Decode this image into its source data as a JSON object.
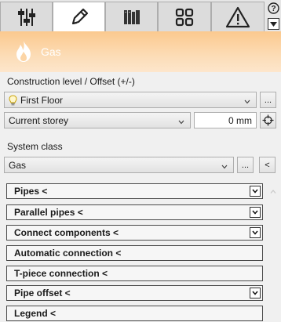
{
  "tabs": [
    {
      "name": "settings-sliders-icon",
      "active": false
    },
    {
      "name": "pencil-icon",
      "active": true
    },
    {
      "name": "library-books-icon",
      "active": false
    },
    {
      "name": "grid-apps-icon",
      "active": false
    },
    {
      "name": "warning-icon",
      "active": false
    }
  ],
  "help": {
    "label": "?"
  },
  "header": {
    "title": "Gas",
    "accent_color": "#fbc98e"
  },
  "construction": {
    "label": "Construction level / Offset (+/-)",
    "level_value": "First Floor",
    "more_label": "...",
    "reference_value": "Current storey",
    "offset_value": "0 mm"
  },
  "system": {
    "label": "System class",
    "value": "Gas",
    "more_label": "...",
    "pick_label": "<"
  },
  "sections": [
    {
      "label": "Pipes <",
      "expandable": true
    },
    {
      "label": "Parallel pipes <",
      "expandable": true
    },
    {
      "label": "Connect components <",
      "expandable": true
    },
    {
      "label": "Automatic connection <",
      "expandable": false
    },
    {
      "label": "T-piece connection <",
      "expandable": false
    },
    {
      "label": "Pipe offset <",
      "expandable": true
    },
    {
      "label": "Legend <",
      "expandable": false
    }
  ]
}
